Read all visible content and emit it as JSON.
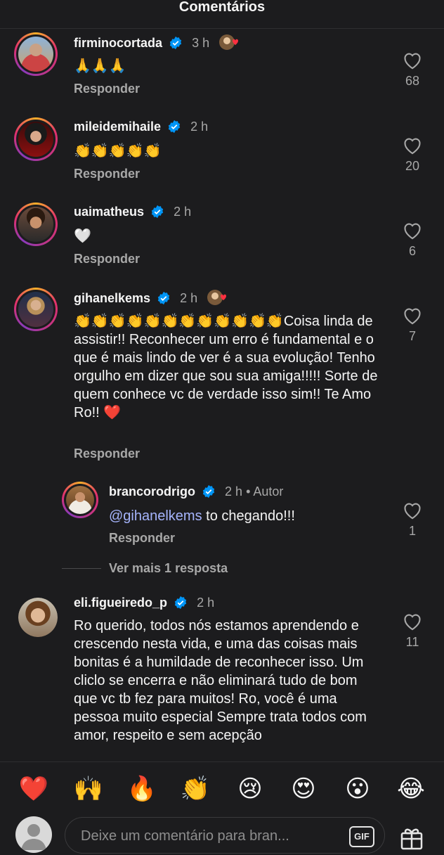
{
  "header": {
    "title": "Comentários"
  },
  "comments": [
    {
      "username": "firminocortada",
      "time": "3 h",
      "text": "🙏🙏🙏",
      "reply": "Responder",
      "likes": "68",
      "has_reaction": true
    },
    {
      "username": "mileidemihaile",
      "time": "2 h",
      "text": "👏👏👏👏👏",
      "reply": "Responder",
      "likes": "20"
    },
    {
      "username": "uaimatheus",
      "time": "2 h",
      "text": "🤍",
      "reply": "Responder",
      "likes": "6"
    },
    {
      "username": "gihanelkems",
      "time": "2 h",
      "text": "👏👏👏👏👏👏👏👏👏👏👏👏Coisa linda de assistir!! Reconhecer um erro é fundamental e o que é mais lindo de ver é a sua evolução! Tenho orgulho em dizer que sou sua amiga!!!!! Sorte de quem conhece vc de verdade isso sim!! Te Amo Ro!! ❤️",
      "reply": "Responder",
      "likes": "7",
      "has_reaction": true
    },
    {
      "username": "brancorodrigo",
      "time": "2 h",
      "author_label": "• Autor",
      "mention": "@gihanelkems",
      "text": " to chegando!!!",
      "reply": "Responder",
      "likes": "1"
    },
    {
      "username": "eli.figueiredo_p",
      "time": "2 h",
      "text": "Ro querido, todos nós estamos aprendendo e crescendo nesta vida, e uma das coisas mais bonitas é a humildade de reconhecer isso. Um cliclo se encerra e não eliminará tudo de bom que vc tb fez para muitos! Ro, você é uma pessoa muito especial Sempre trata todos com amor, respeito e sem acepção",
      "likes": "11"
    }
  ],
  "see_more_replies": "Ver mais 1 resposta",
  "quick_reactions": [
    "❤️",
    "🙌",
    "🔥",
    "👏",
    "😢",
    "😍",
    "😮",
    "😂"
  ],
  "composer": {
    "placeholder": "Deixe um comentário para bran...",
    "gif_label": "GIF"
  },
  "colors": {
    "background": "#1c1c1e",
    "verified": "#0095f6",
    "like": "#a8a8a8"
  }
}
